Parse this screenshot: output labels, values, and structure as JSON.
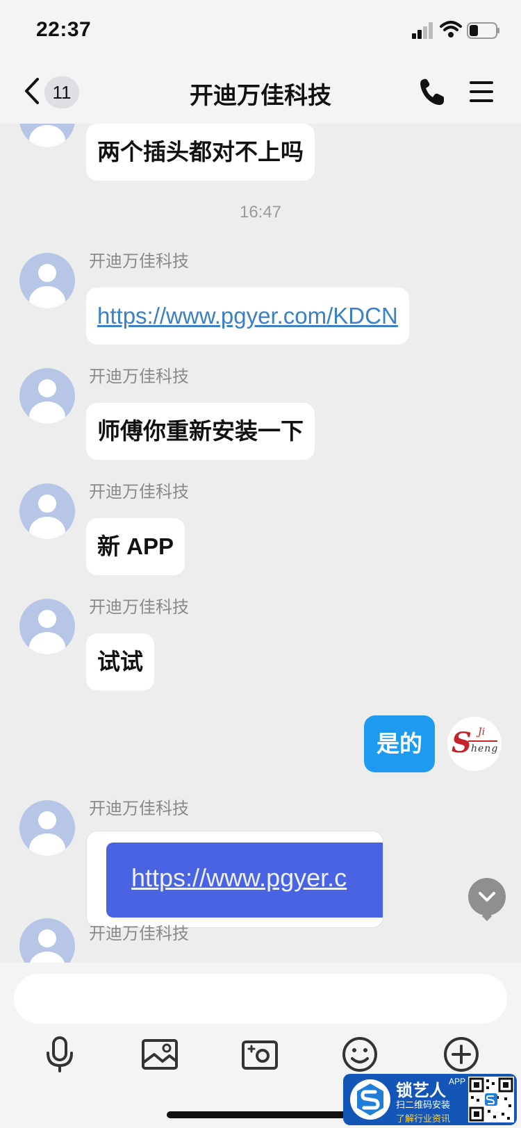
{
  "status_bar": {
    "time": "22:37"
  },
  "nav": {
    "unread_count": "11",
    "title": "开迪万佳科技"
  },
  "chat": {
    "partial_message": "两个插头都对不上吗",
    "timestamp": "16:47",
    "messages": [
      {
        "sender": "开迪万佳科技",
        "text": "https://www.pgyer.com/KDCN",
        "type": "link"
      },
      {
        "sender": "开迪万佳科技",
        "text": "师傅你重新安装一下",
        "type": "text"
      },
      {
        "sender": "开迪万佳科技",
        "text": "新 APP",
        "type": "text"
      },
      {
        "sender": "开迪万佳科技",
        "text": "试试",
        "type": "text"
      },
      {
        "sender": "开迪万佳科技",
        "text": "https://www.pgyer.c",
        "type": "image"
      },
      {
        "sender": "开迪万佳科技",
        "text": "",
        "type": "partial"
      }
    ],
    "self_message": "是的",
    "self_avatar": {
      "logo_s": "S",
      "logo_ji": "Ji",
      "logo_heng": "heng"
    }
  },
  "input": {
    "value": "",
    "placeholder": ""
  },
  "toolbar": [
    "microphone-icon",
    "image-icon",
    "camera-icon",
    "emoji-icon",
    "plus-icon"
  ],
  "watermark": {
    "title": "锁艺人",
    "app": "APP",
    "line1": "扫二维码安装",
    "line2": "了解行业资讯"
  },
  "colors": {
    "self_bubble": "#1e9bf0",
    "link": "#3a80c9",
    "avatar": "#b7c6e6",
    "background": "#ededed"
  }
}
